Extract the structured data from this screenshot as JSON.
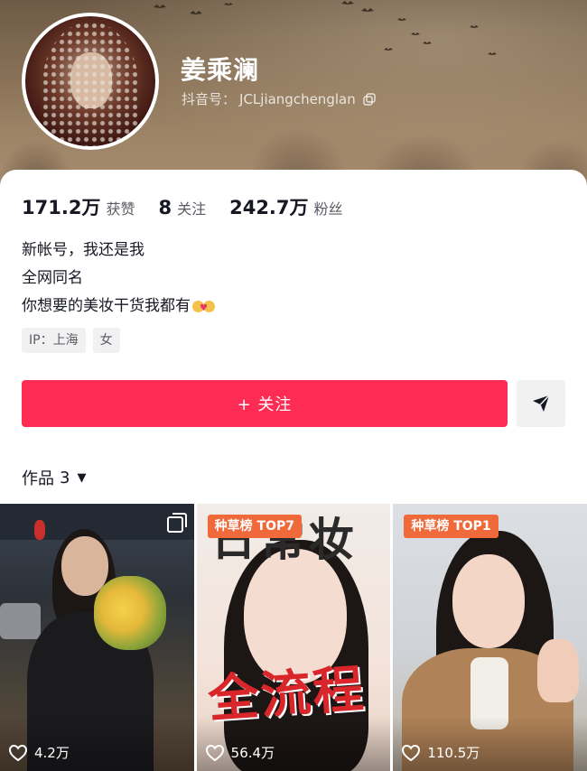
{
  "profile": {
    "name": "姜乘澜",
    "douyin_id_label": "抖音号：",
    "douyin_id": "JCLjiangchenglan"
  },
  "stats": [
    {
      "value": "171.2万",
      "label": "获赞"
    },
    {
      "value": "8",
      "label": "关注"
    },
    {
      "value": "242.7万",
      "label": "粉丝"
    }
  ],
  "bio": {
    "lines": [
      "新帐号，我还是我",
      "全网同名",
      "你想要的美妆干货我都有"
    ],
    "emoji": "couple-with-heart-emoji"
  },
  "tags": [
    "IP：上海",
    "女"
  ],
  "actions": {
    "follow_label": "+ 关注",
    "share_icon": "send-icon"
  },
  "works": {
    "label": "作品",
    "count": "3",
    "caret": "▼"
  },
  "videos": [
    {
      "likes": "4.2万",
      "badge": "",
      "overlay": [],
      "multi_image": true
    },
    {
      "likes": "56.4万",
      "badge": "种草榜 TOP7",
      "overlay": [
        "日常妆",
        "全流程"
      ],
      "multi_image": false
    },
    {
      "likes": "110.5万",
      "badge": "种草榜 TOP1",
      "overlay": [],
      "multi_image": false
    }
  ],
  "colors": {
    "accent": "#fe2c55",
    "badge": "#f0693a",
    "text_primary": "#161823",
    "text_secondary": "#5a5b63"
  }
}
